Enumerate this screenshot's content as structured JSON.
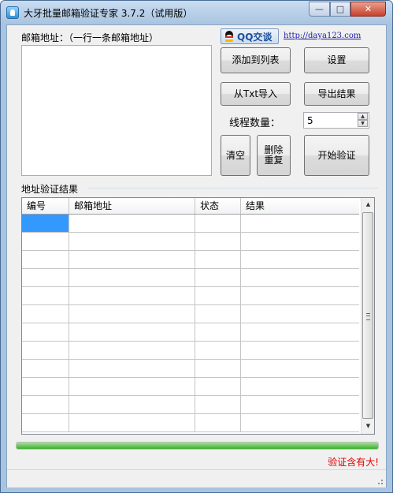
{
  "window": {
    "title": "大牙批量邮箱验证专家 3.7.2（试用版）",
    "minimize_glyph": "—",
    "maximize_glyph": "□",
    "close_glyph": "✕"
  },
  "input_panel": {
    "label": "邮箱地址：（一行一条邮箱地址）",
    "value": ""
  },
  "qq": {
    "label": "QQ交谈",
    "icon": "qq-penguin-icon"
  },
  "website": {
    "text": "http://daya123.com"
  },
  "buttons": {
    "add_to_list": "添加到列表",
    "settings": "设置",
    "import_txt": "从Txt导入",
    "export_results": "导出结果",
    "clear": "清空",
    "remove_duplicates": "删除\n重复",
    "start_verify": "开始验证"
  },
  "threads": {
    "label": "线程数量：",
    "value": "5"
  },
  "results": {
    "title": "地址验证结果",
    "columns": [
      "编号",
      "邮箱地址",
      "状态",
      "结果"
    ],
    "rows": []
  },
  "progress": {
    "value": 1.0,
    "fill_color": "#3bb02d"
  },
  "slogan": {
    "text": "验证含有大!",
    "color": "#e00000"
  }
}
